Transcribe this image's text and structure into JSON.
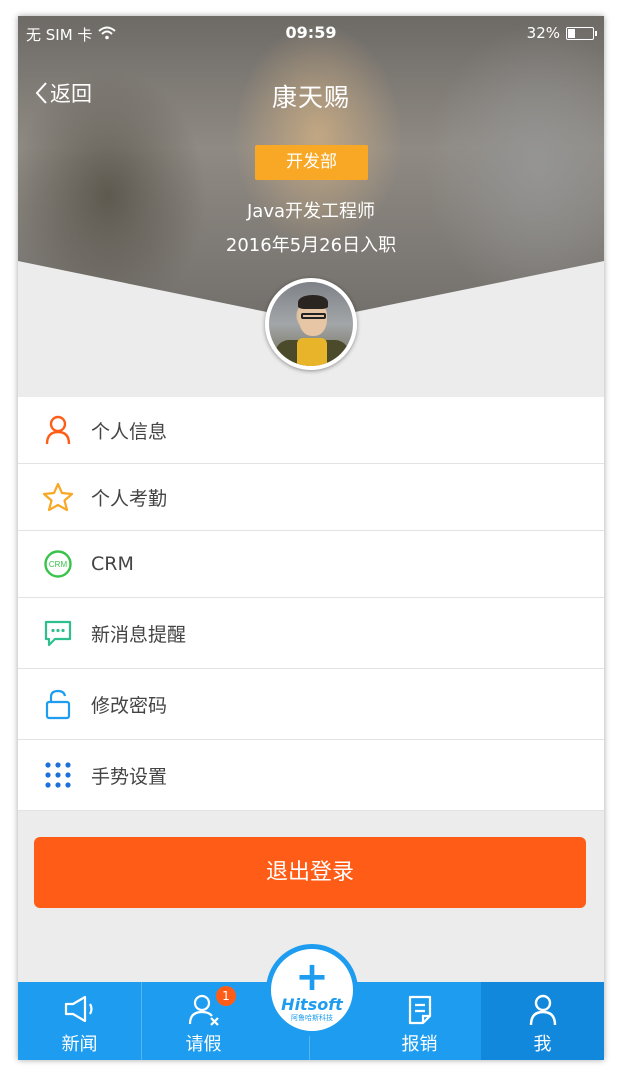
{
  "status_bar": {
    "carrier": "无 SIM 卡",
    "time": "09:59",
    "battery": "32%",
    "battery_level": 0.32
  },
  "nav": {
    "back_label": "返回",
    "title": "康天赐"
  },
  "profile": {
    "department": "开发部",
    "job_title": "Java开发工程师",
    "join_date": "2016年5月26日入职"
  },
  "menu": [
    {
      "label": "个人信息",
      "icon": "person-icon",
      "color": "#ff5d17"
    },
    {
      "label": "个人考勤",
      "icon": "star-icon",
      "color": "#f9a825"
    },
    {
      "label": "CRM",
      "icon": "crm-icon",
      "icon_text": "CRM",
      "color": "#3ac34a"
    },
    {
      "label": "新消息提醒",
      "icon": "message-icon",
      "color": "#2fbf8f"
    },
    {
      "label": "修改密码",
      "icon": "lock-icon",
      "color": "#1e9df0"
    },
    {
      "label": "手势设置",
      "icon": "grid-dots-icon",
      "color": "#1e6fd8"
    }
  ],
  "logout_label": "退出登录",
  "tabbar": {
    "tabs": [
      {
        "label": "新闻",
        "icon": "megaphone-icon"
      },
      {
        "label": "请假",
        "icon": "leave-icon",
        "badge": "1"
      },
      {
        "label": "报销",
        "icon": "document-icon"
      },
      {
        "label": "我",
        "icon": "user-icon",
        "active": true
      }
    ],
    "center": {
      "plus": "+",
      "brand": "Hitsoft",
      "brand_sub": "阿鲁哈斯科技"
    }
  },
  "colors": {
    "accent": "#1e9df0",
    "logout": "#ff5d17",
    "badge": "#f9a825"
  }
}
